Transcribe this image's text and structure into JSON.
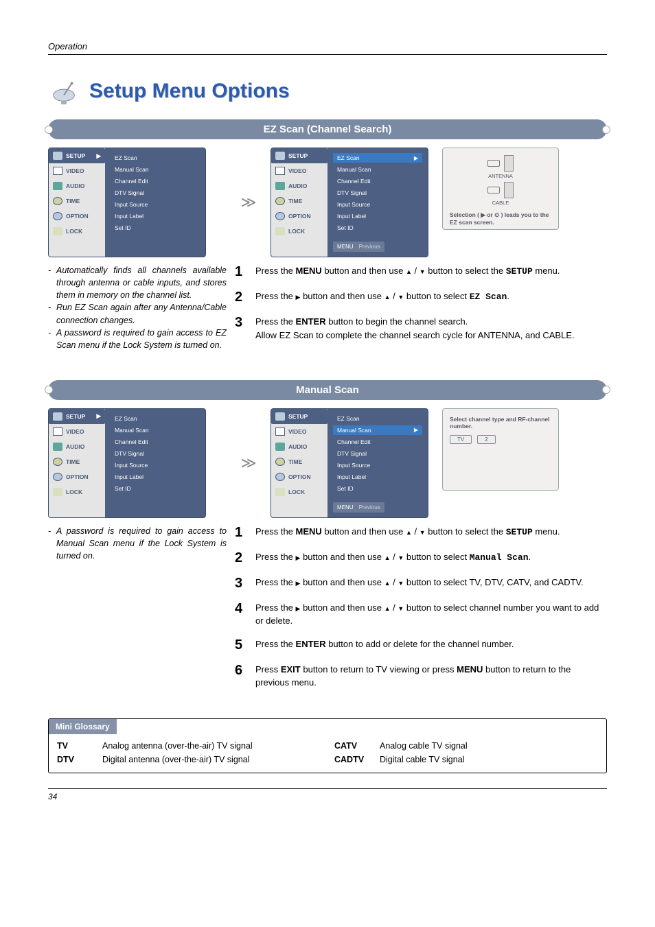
{
  "header": {
    "section": "Operation"
  },
  "title": "Setup Menu Options",
  "sections": {
    "ez_scan": {
      "banner": "EZ Scan (Channel Search)",
      "desc": [
        "Automatically finds all channels available through antenna or cable inputs, and stores them in memory on the channel list.",
        "Run EZ Scan again after any Antenna/Cable connection changes.",
        "A password is required to gain access to EZ Scan menu if the Lock System is turned on."
      ],
      "steps": {
        "s1a": "Press the ",
        "s1b": "MENU",
        "s1c": " button and then use ",
        "s1d": " button to select the ",
        "s1e": "SETUP",
        "s1f": " menu.",
        "s2a": "Press the ",
        "s2b": " button and then use ",
        "s2c": " button to select ",
        "s2d": "EZ Scan",
        "s2e": ".",
        "s3a": "Press the ",
        "s3b": "ENTER",
        "s3c": " button to begin the channel search.",
        "s3d": "Allow EZ Scan to complete the channel search cycle for ANTENNA, and CABLE."
      },
      "help": {
        "ant": "ANTENNA",
        "cable": "CABLE",
        "line": "Selection ( ▶ or ⊙ ) leads you to the EZ scan screen."
      },
      "osd_selected": "EZ Scan",
      "osd_footer": {
        "menu": "MENU",
        "prev": "Previous"
      }
    },
    "manual_scan": {
      "banner": "Manual Scan",
      "desc": [
        "A password is required to gain access to Manual Scan menu if the Lock System is turned on."
      ],
      "steps": {
        "s1a": "Press the ",
        "s1b": "MENU",
        "s1c": " button and then use ",
        "s1d": " button to select the ",
        "s1e": "SETUP",
        "s1f": " menu.",
        "s2a": "Press the ",
        "s2b": " button and then use ",
        "s2c": " button to select ",
        "s2d": "Manual Scan",
        "s2e": ".",
        "s3a": "Press the ",
        "s3b": " button and then use ",
        "s3c": " button to select TV, DTV, CATV, and CADTV.",
        "s4a": "Press the ",
        "s4b": " button and then use ",
        "s4c": " button to select channel number you want to add or delete.",
        "s5a": "Press the ",
        "s5b": "ENTER",
        "s5c": " button to add or delete for the channel number.",
        "s6a": "Press ",
        "s6b": "EXIT",
        "s6c": " button to return to TV viewing or press ",
        "s6d": "MENU",
        "s6e": " button to return to the previous menu."
      },
      "help": {
        "line": "Select channel type and RF-channel number.",
        "pill1": "TV",
        "pill2": "2"
      },
      "osd_selected": "Manual Scan",
      "osd_footer": {
        "menu": "MENU",
        "prev": "Previous"
      }
    }
  },
  "osd": {
    "tabs": [
      "SETUP",
      "VIDEO",
      "AUDIO",
      "TIME",
      "OPTION",
      "LOCK"
    ],
    "items": [
      "EZ Scan",
      "Manual Scan",
      "Channel Edit",
      "DTV Signal",
      "Input Source",
      "Input Label",
      "Set ID"
    ],
    "setup_arrow": "▶"
  },
  "glossary": {
    "title": "Mini Glossary",
    "rows": [
      {
        "term": "TV",
        "def": "Analog antenna (over-the-air) TV signal"
      },
      {
        "term": "DTV",
        "def": "Digital antenna (over-the-air) TV signal"
      },
      {
        "term": "CATV",
        "def": "Analog cable TV signal"
      },
      {
        "term": "CADTV",
        "def": "Digital cable TV signal"
      }
    ]
  },
  "page_number": "34"
}
